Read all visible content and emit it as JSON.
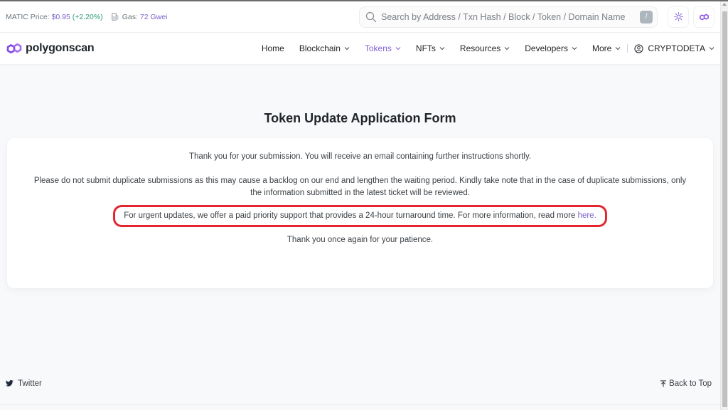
{
  "topbar": {
    "price_label": "MATIC Price:",
    "price_value": "$0.95",
    "price_change": "(+2.20%)",
    "gas_label": "Gas:",
    "gas_value": "72 Gwei",
    "gas_icon": "gas-pump-icon",
    "search_placeholder": "Search by Address / Txn Hash / Block / Token / Domain Name",
    "search_shortcut": "/",
    "theme_icon": "sun-icon",
    "network_icon": "polygon-icon"
  },
  "navbar": {
    "logo_text": "polygonscan",
    "items": [
      {
        "label": "Home",
        "dropdown": false,
        "active": false
      },
      {
        "label": "Blockchain",
        "dropdown": true,
        "active": false
      },
      {
        "label": "Tokens",
        "dropdown": true,
        "active": true
      },
      {
        "label": "NFTs",
        "dropdown": true,
        "active": false
      },
      {
        "label": "Resources",
        "dropdown": true,
        "active": false
      },
      {
        "label": "Developers",
        "dropdown": true,
        "active": false
      },
      {
        "label": "More",
        "dropdown": true,
        "active": false
      }
    ],
    "user_label": "CRYPTODETA"
  },
  "main": {
    "title": "Token Update Application Form",
    "paragraphs": {
      "thanks": "Thank you for your submission. You will receive an email containing further instructions shortly.",
      "duplicates_line1": "Please do not submit duplicate submissions as this may cause a backlog on our end and lengthen the waiting period. Kindly take note that in the case of duplicate submissions, only",
      "duplicates_line2": "the information submitted in the latest ticket will be reviewed.",
      "urgent": "For urgent updates, we offer a paid priority support that provides a 24-hour turnaround time. For more information, read more ",
      "urgent_link": "here",
      "urgent_end": ".",
      "closing": "Thank you once again for your patience."
    },
    "highlight_color": "#e5262f"
  },
  "footer": {
    "twitter_label": "Twitter",
    "back_to_top_label": "Back to Top"
  },
  "colors": {
    "accent": "#8461d8",
    "link": "#7b61c9",
    "positive": "#2a9d6f"
  }
}
